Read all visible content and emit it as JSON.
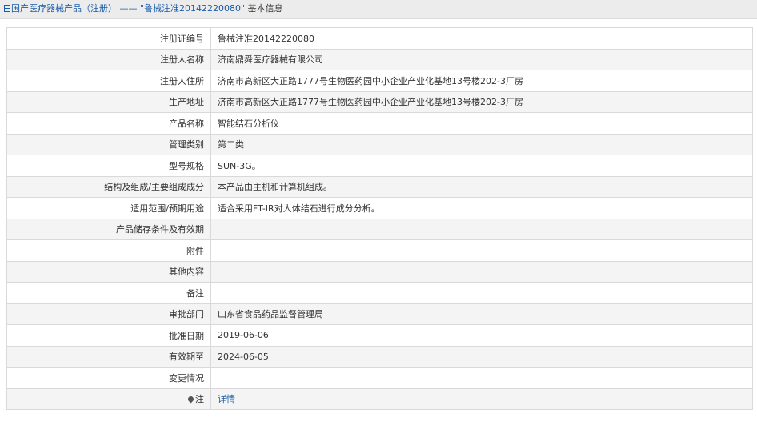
{
  "breadcrumb": {
    "root": "国产医疗器械产品（注册）",
    "separator": "——",
    "current": "\"鲁械注准20142220080\"",
    "suffix": "基本信息"
  },
  "rows": [
    {
      "label": "注册证编号",
      "value": "鲁械注准20142220080"
    },
    {
      "label": "注册人名称",
      "value": "济南鼎舜医疗器械有限公司"
    },
    {
      "label": "注册人住所",
      "value": "济南市高新区大正路1777号生物医药园中小企业产业化基地13号楼202-3厂房"
    },
    {
      "label": "生产地址",
      "value": "济南市高新区大正路1777号生物医药园中小企业产业化基地13号楼202-3厂房"
    },
    {
      "label": "产品名称",
      "value": "智能结石分析仪"
    },
    {
      "label": "管理类别",
      "value": "第二类"
    },
    {
      "label": "型号规格",
      "value": "SUN-3G。"
    },
    {
      "label": "结构及组成/主要组成成分",
      "value": "本产品由主机和计算机组成。"
    },
    {
      "label": "适用范围/预期用途",
      "value": "适合采用FT-IR对人体结石进行成分分析。"
    },
    {
      "label": "产品储存条件及有效期",
      "value": ""
    },
    {
      "label": "附件",
      "value": ""
    },
    {
      "label": "其他内容",
      "value": ""
    },
    {
      "label": "备注",
      "value": ""
    },
    {
      "label": "审批部门",
      "value": "山东省食品药品监督管理局"
    },
    {
      "label": "批准日期",
      "value": "2019-06-06"
    },
    {
      "label": "有效期至",
      "value": "2024-06-05"
    },
    {
      "label": "变更情况",
      "value": ""
    }
  ],
  "note_row": {
    "label": "注",
    "link": "详情"
  }
}
